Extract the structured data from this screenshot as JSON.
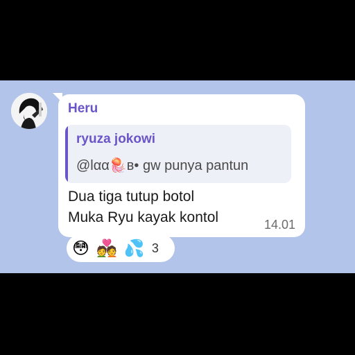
{
  "message": {
    "sender": "Heru",
    "reply": {
      "author": "ryuza jokowi",
      "text": "@lαα🪼ʙ• gw punya pantun"
    },
    "lines": [
      "Dua tiga tutup botol",
      "Muka Ryu kayak kontol"
    ],
    "timestamp": "14.01"
  },
  "reactions": {
    "emojis": [
      "😳",
      "💑",
      "💦"
    ],
    "count": "3"
  },
  "colors": {
    "chat_background": "#b3c4ea",
    "accent": "#6a55c8",
    "bubble": "#ffffff"
  }
}
